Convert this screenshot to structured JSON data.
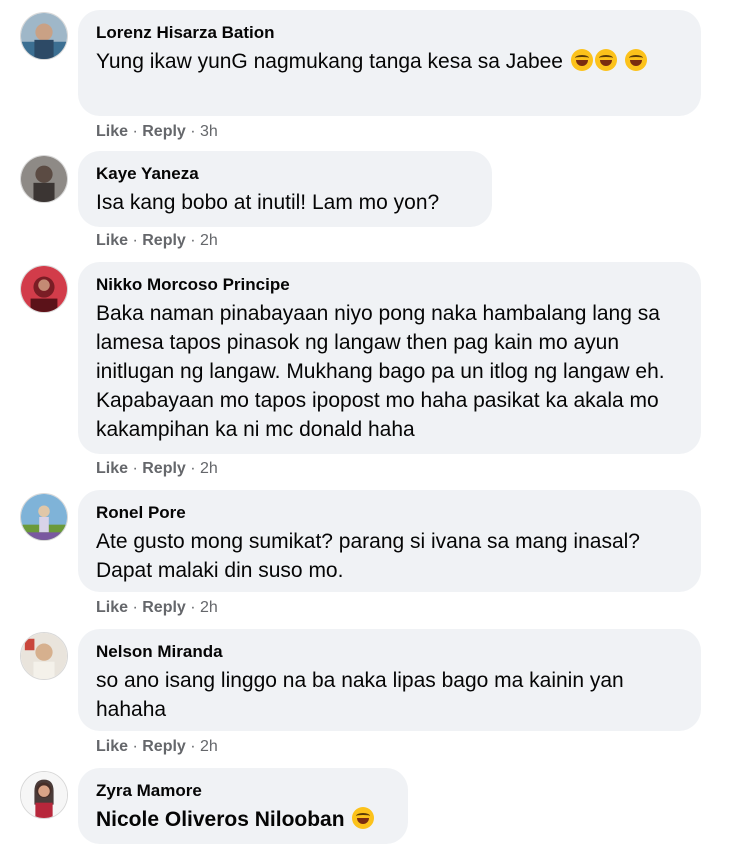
{
  "colors": {
    "bubble": "#f0f2f5",
    "meta": "#65676b",
    "emoji": "#fcc21b"
  },
  "actions": {
    "like": "Like",
    "reply": "Reply",
    "sep": " · "
  },
  "comments": [
    {
      "author": "Lorenz Hisarza Bation",
      "text": "Yung ikaw yunG nagmukang tanga kesa sa Jabee",
      "emoji": "rolling-on-floor-laughing-icon",
      "time": "3h"
    },
    {
      "author": "Kaye Yaneza",
      "text": "Isa kang bobo at inutil! Lam mo yon?",
      "time": "2h"
    },
    {
      "author": "Nikko Morcoso Principe",
      "text": "Baka naman pinabayaan niyo pong naka hambalang lang sa lamesa tapos pinasok ng langaw then pag kain mo ayun initlugan ng langaw. Mukhang bago pa un itlog ng langaw eh. Kapabayaan mo tapos ipopost mo haha pasikat ka akala mo kakampihan ka ni mc donald haha",
      "time": "2h"
    },
    {
      "author": "Ronel Pore",
      "text": "Ate gusto mong sumikat? parang si ivana sa mang inasal? Dapat malaki din suso mo.",
      "time": "2h"
    },
    {
      "author": "Nelson Miranda",
      "text": "so ano isang linggo na ba naka lipas bago ma kainin yan hahaha",
      "time": "2h"
    },
    {
      "author": "Zyra Mamore",
      "text": "Nicole Oliveros Nilooban",
      "emoji": "rolling-on-floor-laughing-icon"
    }
  ]
}
